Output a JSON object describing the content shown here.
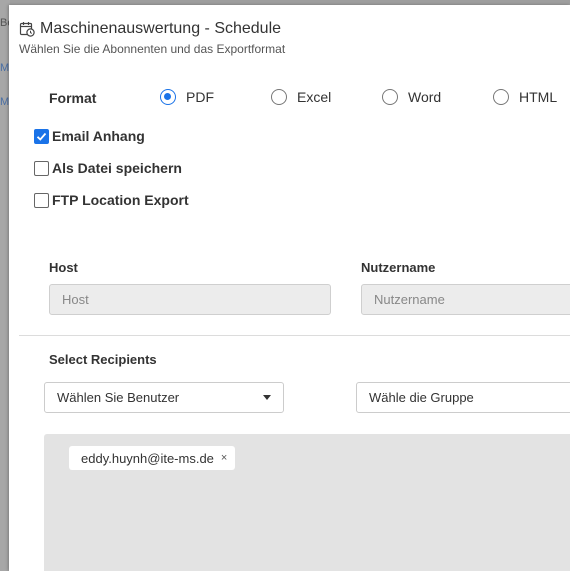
{
  "background": {
    "fragments": [
      "Be",
      "Ma",
      "Ma"
    ]
  },
  "dialog": {
    "title": "Maschinenauswertung - Schedule",
    "subtitle": "Wählen Sie die Abonnenten und das Exportformat",
    "title_icon": "calendar-clock-icon"
  },
  "format": {
    "label": "Format",
    "options": [
      {
        "label": "PDF",
        "checked": true
      },
      {
        "label": "Excel",
        "checked": false
      },
      {
        "label": "Word",
        "checked": false
      },
      {
        "label": "HTML",
        "checked": false
      }
    ]
  },
  "delivery": [
    {
      "label": "Email Anhang",
      "checked": true
    },
    {
      "label": "Als Datei speichern",
      "checked": false
    },
    {
      "label": "FTP Location Export",
      "checked": false
    }
  ],
  "ftp": {
    "host_label": "Host",
    "host_placeholder": "Host",
    "user_label": "Nutzername",
    "user_placeholder": "Nutzername"
  },
  "recipients": {
    "label": "Select Recipients",
    "user_select": "Wählen Sie Benutzer",
    "group_select": "Wähle die Gruppe",
    "tags": [
      {
        "email": "eddy.huynh@ite-ms.de",
        "remove": "×"
      }
    ]
  },
  "colors": {
    "accent": "#1a73e8",
    "input_bg": "#ececec",
    "recipients_bg": "#e3e3e3"
  }
}
